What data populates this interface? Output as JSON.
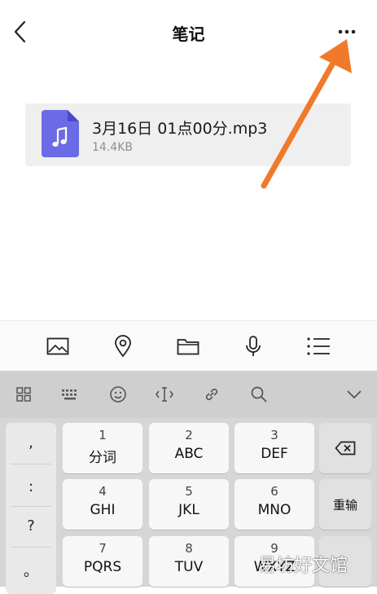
{
  "header": {
    "title": "笔记"
  },
  "attachment": {
    "file_name": "3月16日 01点00分.mp3",
    "file_size": "14.4KB"
  },
  "toolbar": {
    "icons": [
      "image-icon",
      "location-icon",
      "folder-icon",
      "microphone-icon",
      "list-icon"
    ]
  },
  "keyboard": {
    "top_icons": [
      "grid-icon",
      "keyboard-icon",
      "emoji-icon",
      "cursor-icon",
      "link-icon",
      "search-icon",
      "chevron-down-icon"
    ],
    "punctuation": [
      ",",
      ":",
      "?",
      "。"
    ],
    "keys": [
      {
        "num": "1",
        "label": "分词"
      },
      {
        "num": "2",
        "label": "ABC"
      },
      {
        "num": "3",
        "label": "DEF"
      },
      {
        "num": "4",
        "label": "GHI"
      },
      {
        "num": "5",
        "label": "JKL"
      },
      {
        "num": "6",
        "label": "MNO"
      },
      {
        "num": "7",
        "label": "PQRS"
      },
      {
        "num": "8",
        "label": "TUV"
      },
      {
        "num": "9",
        "label": "WXYZ"
      }
    ],
    "reinput_label": "重输"
  },
  "watermark": "易坊好文馆",
  "colors": {
    "file_icon": "#6b6be6",
    "arrow": "#f07a2a"
  }
}
